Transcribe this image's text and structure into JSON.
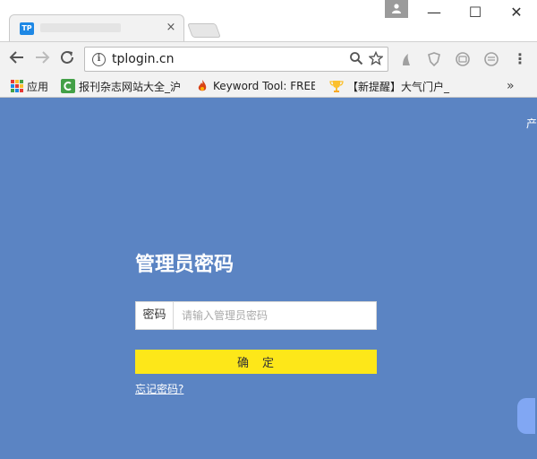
{
  "colors": {
    "page_bg": "#5b84c3",
    "confirm_button": "#fde719",
    "favicon": "#1e88e5"
  },
  "tab": {
    "favicon_text": "TP",
    "title": "",
    "close_symbol": "×"
  },
  "window_controls": {
    "minimize": "—",
    "maximize": "☐",
    "close": "✕"
  },
  "toolbar": {
    "url": "tplogin.cn",
    "info_symbol": "i"
  },
  "bookmarks": [
    {
      "label": "应用",
      "icon": "apps-grid-icon"
    },
    {
      "label": "报刊杂志网站大全_沪",
      "icon": "c-logo-icon"
    },
    {
      "label": "Keyword Tool: FREE",
      "icon": "flame-icon"
    },
    {
      "label": "【新提醒】大气门户_",
      "icon": "trophy-icon"
    }
  ],
  "bookmarks_more": "»",
  "page": {
    "corner_text": "产",
    "title": "管理员密码",
    "password_label": "密码",
    "password_placeholder": "请输入管理员密码",
    "confirm_label": "确　定",
    "forgot_link": "忘记密码?"
  }
}
